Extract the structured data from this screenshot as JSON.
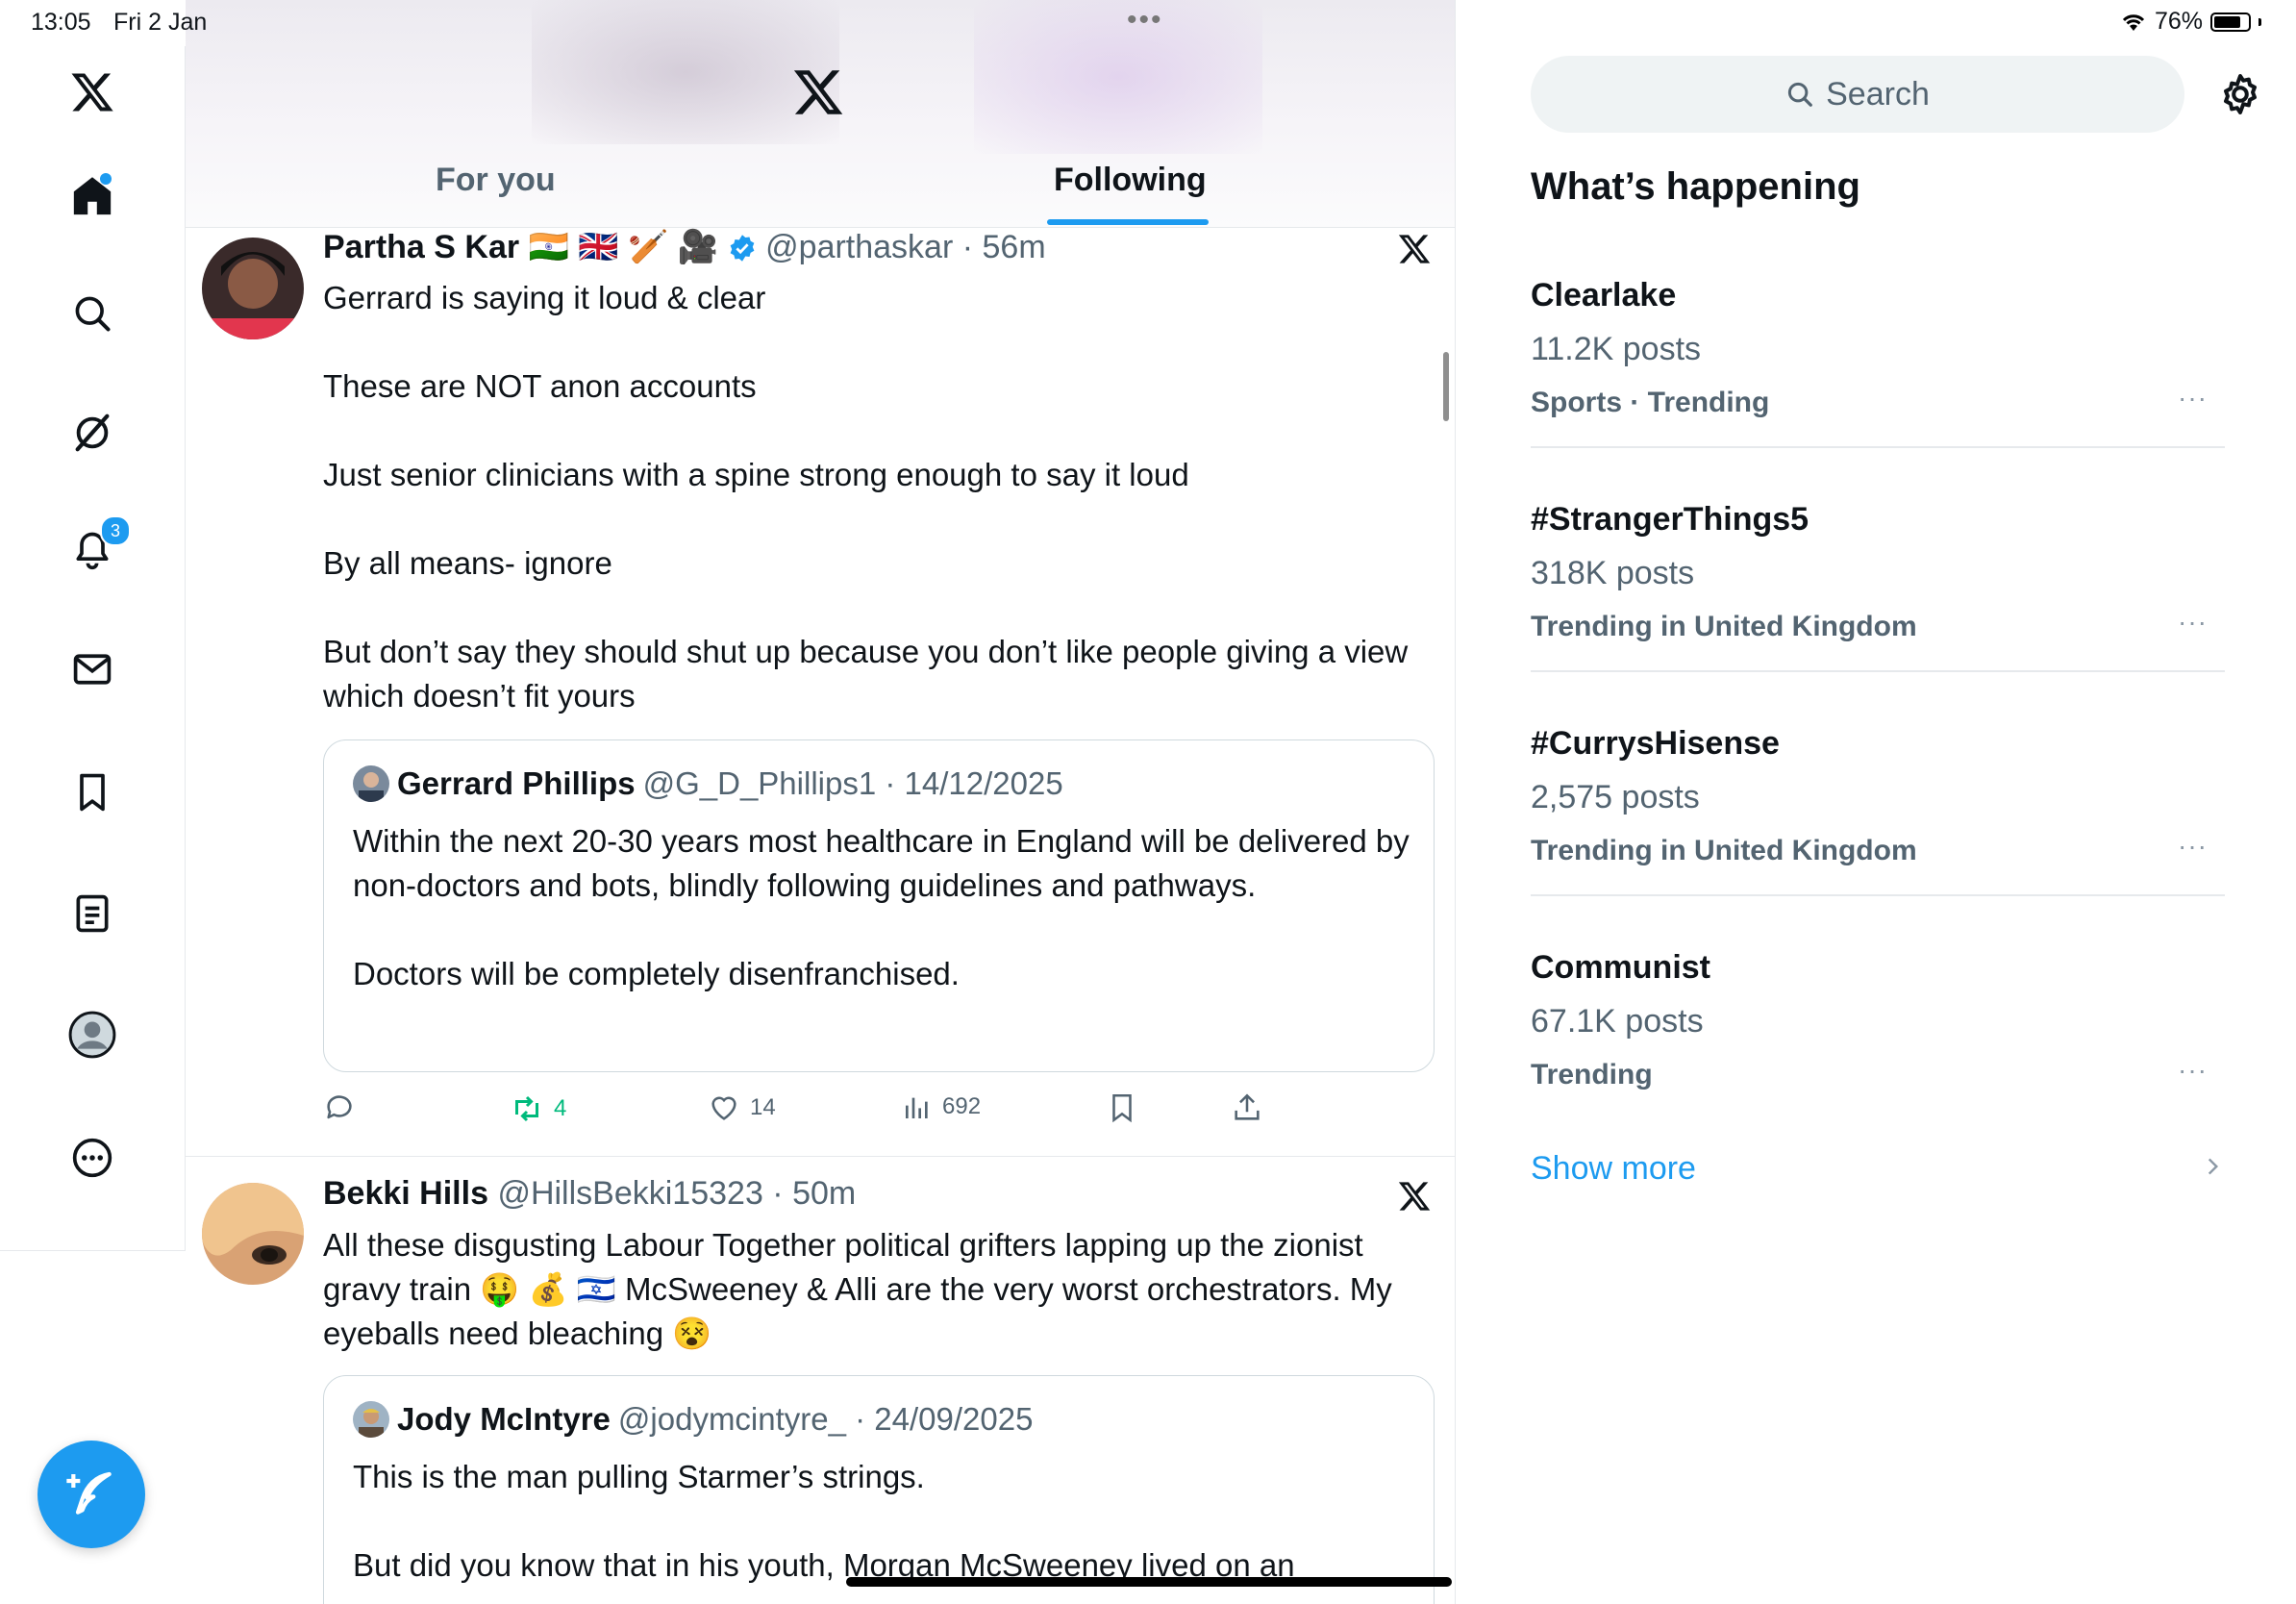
{
  "status_bar": {
    "time": "13:05",
    "date": "Fri 2 Jan",
    "battery": "76%"
  },
  "nav": {
    "items": [
      "x-logo",
      "home",
      "search",
      "grok",
      "notifications",
      "messages",
      "bookmarks",
      "lists",
      "profile",
      "more"
    ],
    "notifications_badge": "3"
  },
  "header": {
    "tabs": [
      {
        "label": "For you",
        "active": false
      },
      {
        "label": "Following",
        "active": true
      }
    ]
  },
  "posts": [
    {
      "name": "Partha S Kar",
      "flags": "🇮🇳 🇬🇧 🏏 🎥",
      "handle_time": "@parthaskar · 56m",
      "verified": true,
      "body": [
        "Gerrard is saying it loud & clear",
        "These are NOT anon accounts",
        "Just senior clinicians with a spine strong enough to say it loud",
        "By all means- ignore",
        "But don’t say they should shut up because you don’t like people giving a view which doesn’t fit yours"
      ],
      "quote": {
        "name": "Gerrard Phillips",
        "handle_time": "@G_D_Phillips1 · 14/12/2025",
        "body": [
          "Within the next 20-30 years most healthcare in England will be delivered by non-doctors and bots, blindly following guidelines and pathways.",
          "Doctors will be completely disenfranchised."
        ]
      },
      "stats": {
        "reposts": "4",
        "likes": "14",
        "views": "692"
      }
    },
    {
      "name": "Bekki Hills",
      "handle_time": "@HillsBekki15323 · 50m",
      "body": [
        "All these disgusting Labour Together political grifters lapping up the zionist gravy train 🤑 💰 🇮🇱 McSweeney & Alli are the very worst orchestrators. My eyeballs need bleaching 😵"
      ],
      "quote": {
        "name": "Jody McIntyre",
        "handle_time": "@jodymcintyre_ · 24/09/2025",
        "body": [
          "This is the man pulling Starmer’s strings.",
          "But did you know that in his youth, Morgan McSweeney lived on an"
        ]
      }
    }
  ],
  "sidebar": {
    "search_placeholder": "Search",
    "title": "What’s happening",
    "trends": [
      {
        "name": "Clearlake",
        "count": "11.2K posts",
        "context": "Sports · Trending"
      },
      {
        "name": "#StrangerThings5",
        "count": "318K posts",
        "context": "Trending in United Kingdom"
      },
      {
        "name": "#CurrysHisense",
        "count": "2,575 posts",
        "context": "Trending in United Kingdom"
      },
      {
        "name": "Communist",
        "count": "67.1K posts",
        "context": "Trending"
      }
    ],
    "more_icon": "···",
    "show_more": "Show more"
  },
  "colors": {
    "accent": "#1d9bf0",
    "repost": "#00ba7c",
    "secondary_text": "#536471",
    "border": "#e6e9ec"
  }
}
